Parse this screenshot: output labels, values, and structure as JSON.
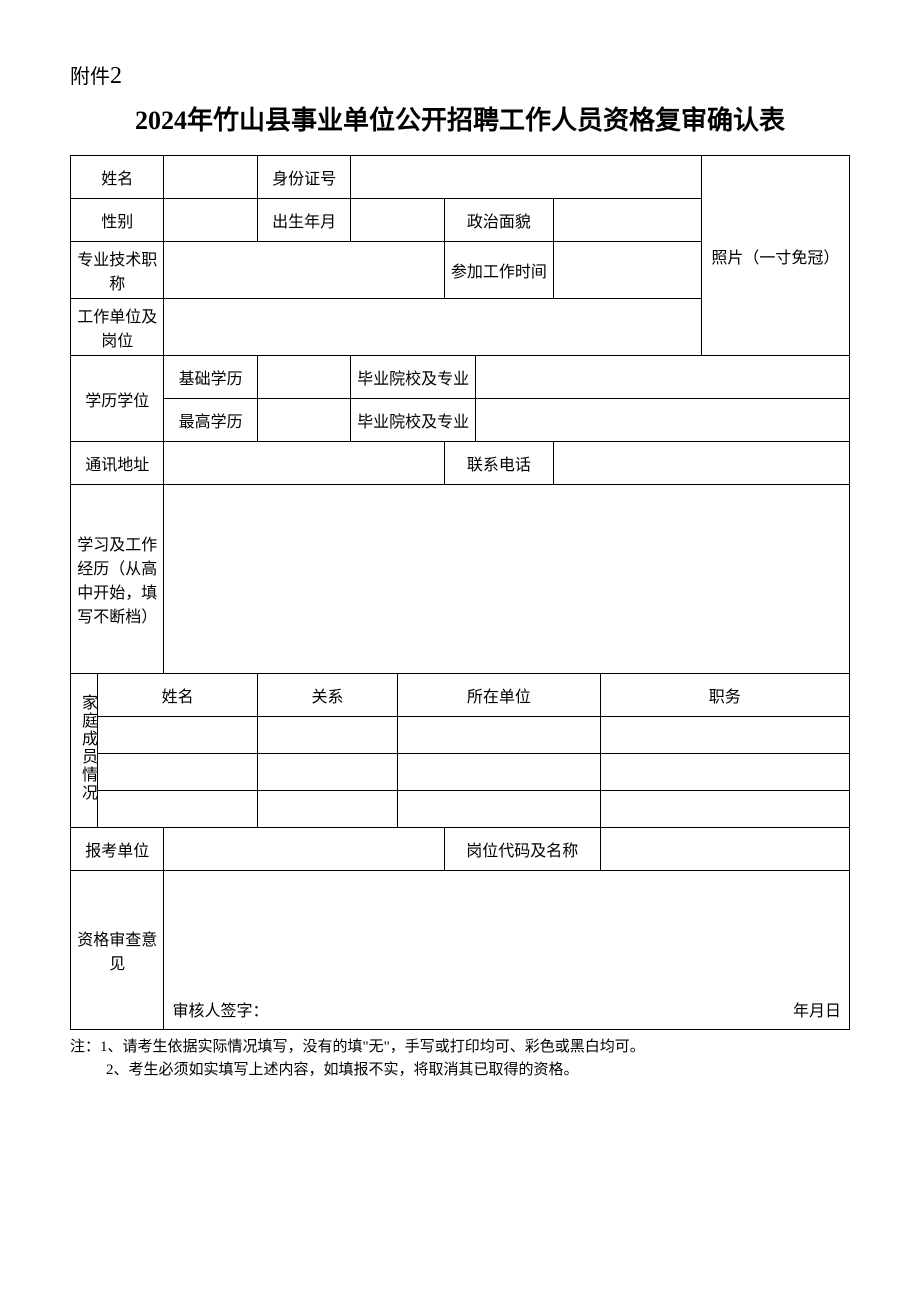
{
  "attachment_prefix": "附件",
  "attachment_num": "2",
  "title": "2024年竹山县事业单位公开招聘工作人员资格复审确认表",
  "labels": {
    "name": "姓名",
    "id_no": "身份证号",
    "gender": "性别",
    "birth": "出生年月",
    "political": "政治面貌",
    "pro_title": "专业技术职称",
    "work_start": "参加工作时间",
    "work_unit_post": "工作单位及岗位",
    "photo": "照片（一寸免冠）",
    "edu_degree": "学历学位",
    "basic_edu": "基础学历",
    "highest_edu": "最高学历",
    "grad_school_major": "毕业院校及专业",
    "address": "通讯地址",
    "phone": "联系电话",
    "experience": "学习及工作经历（从高中开始，填写不断档）",
    "family": "家庭成员情况",
    "fam_name": "姓名",
    "fam_relation": "关系",
    "fam_unit": "所在单位",
    "fam_duty": "职务",
    "apply_unit": "报考单位",
    "post_code_name": "岗位代码及名称",
    "review_opinion": "资格审查意见",
    "reviewer_sign": "审核人签字：",
    "date_ymd": "年月日"
  },
  "values": {
    "name": "",
    "id_no": "",
    "gender": "",
    "birth": "",
    "political": "",
    "pro_title": "",
    "work_start": "",
    "work_unit_post": "",
    "basic_edu": "",
    "basic_school": "",
    "highest_edu": "",
    "highest_school": "",
    "address": "",
    "phone": "",
    "experience": "",
    "apply_unit": "",
    "post_code_name": "",
    "review_opinion": ""
  },
  "family_members": [
    {
      "name": "",
      "relation": "",
      "unit": "",
      "duty": ""
    },
    {
      "name": "",
      "relation": "",
      "unit": "",
      "duty": ""
    },
    {
      "name": "",
      "relation": "",
      "unit": "",
      "duty": ""
    }
  ],
  "notes_prefix": "注：",
  "notes": [
    "1、请考生依据实际情况填写，没有的填\"无\"，手写或打印均可、彩色或黑白均可。",
    "2、考生必须如实填写上述内容，如填报不实，将取消其已取得的资格。"
  ]
}
